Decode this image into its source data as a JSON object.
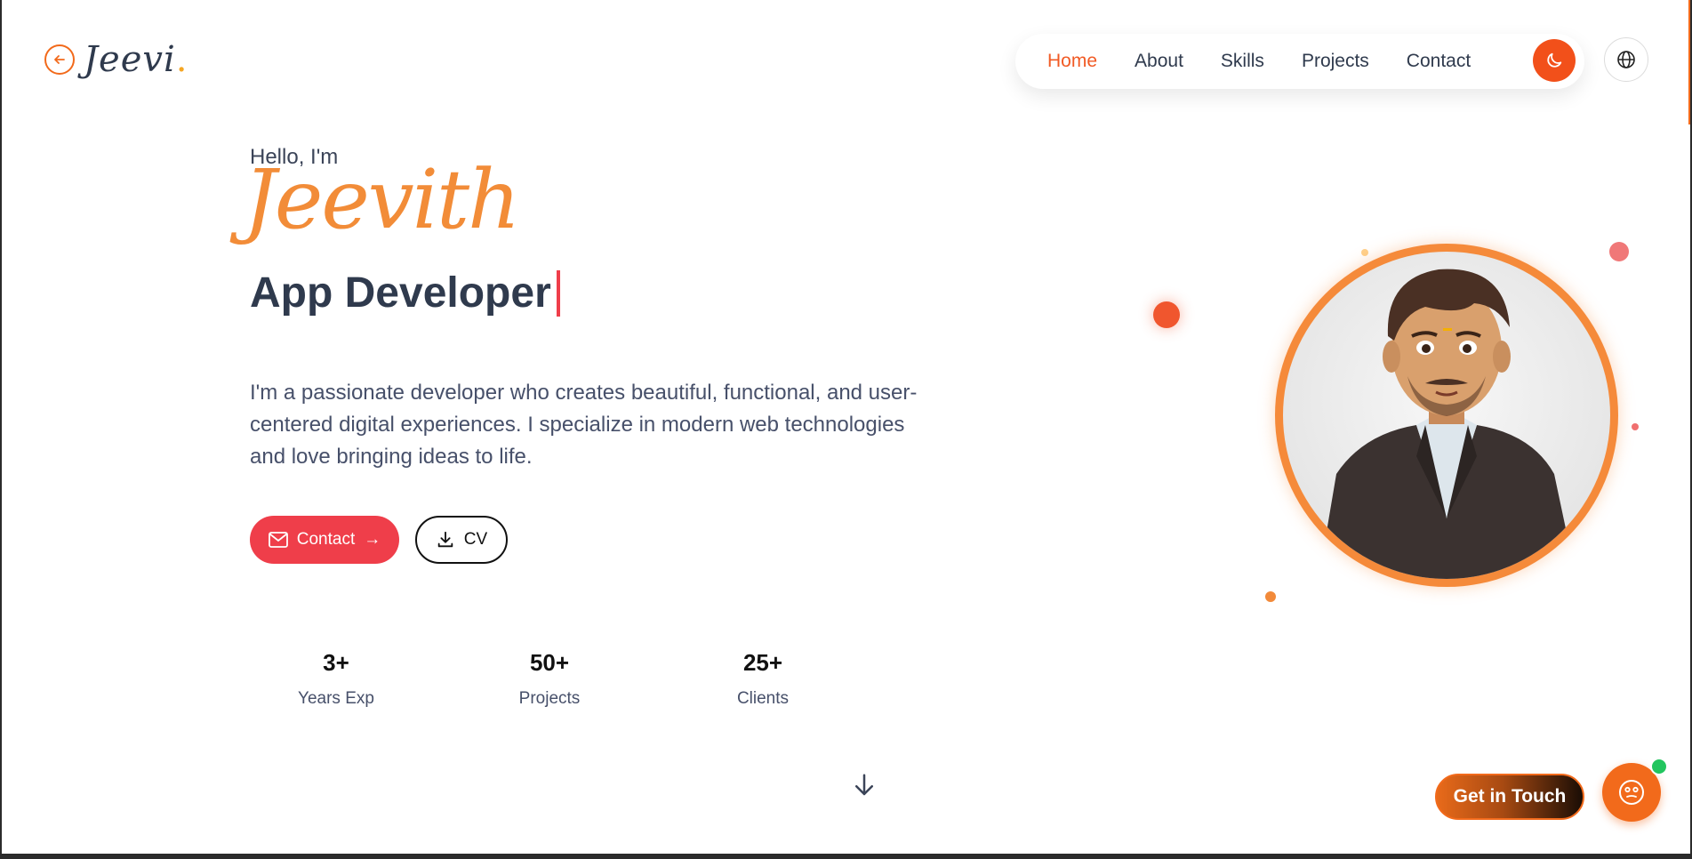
{
  "brand": {
    "name": "Jeevi",
    "dot": "."
  },
  "nav": {
    "items": [
      {
        "label": "Home",
        "active": true
      },
      {
        "label": "About",
        "active": false
      },
      {
        "label": "Skills",
        "active": false
      },
      {
        "label": "Projects",
        "active": false
      },
      {
        "label": "Contact",
        "active": false
      }
    ]
  },
  "hero": {
    "greeting": "Hello, I'm",
    "name": "Jeevith",
    "role": "App Developer",
    "description": "I'm a passionate developer who creates beautiful, functional, and user-centered digital experiences. I specialize in modern web technologies and love bringing ideas to life.",
    "contact_label": "Contact",
    "contact_arrow": "→",
    "cv_label": "CV"
  },
  "stats": [
    {
      "value": "3+",
      "label": "Years Exp"
    },
    {
      "value": "50+",
      "label": "Projects"
    },
    {
      "value": "25+",
      "label": "Clients"
    }
  ],
  "floating": {
    "get_in_touch": "Get in Touch"
  },
  "colors": {
    "accent": "#f15a24",
    "primary_button": "#ef3e4a",
    "name": "#f28c38",
    "text": "#2f3a4d"
  },
  "icons": [
    "back-arrow-icon",
    "moon-icon",
    "globe-icon",
    "mail-icon",
    "download-icon",
    "arrow-down-icon",
    "bot-face-icon"
  ]
}
